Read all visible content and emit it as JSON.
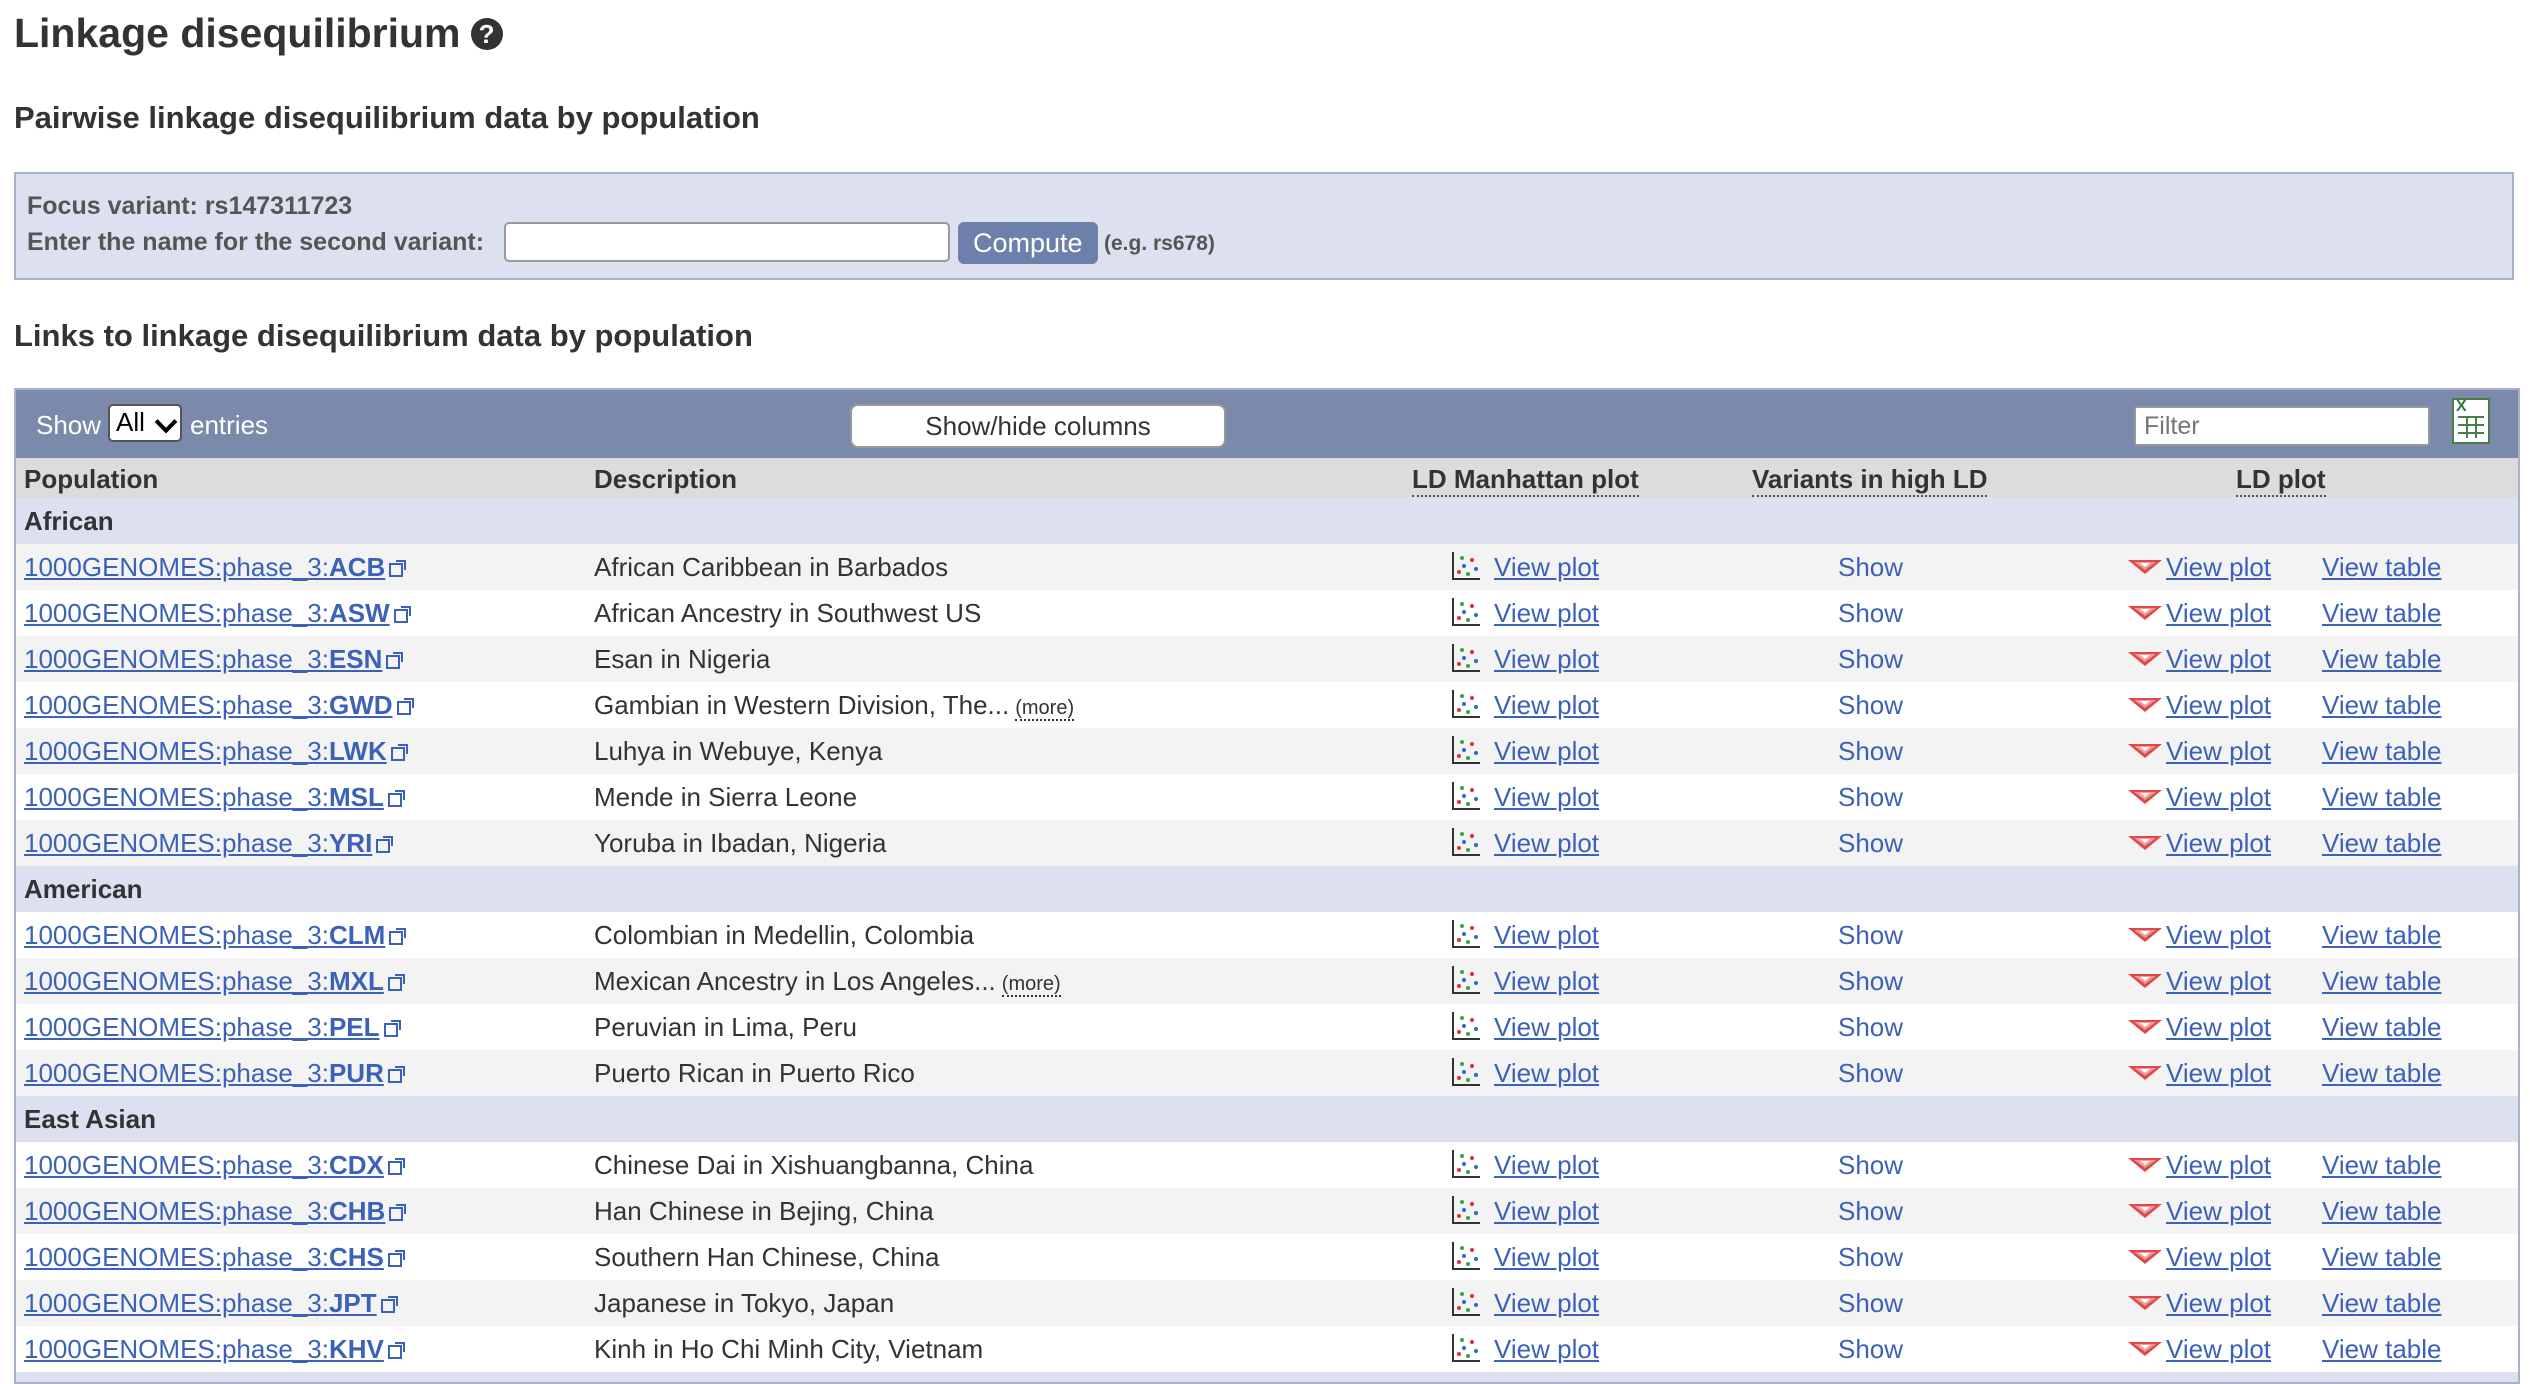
{
  "page": {
    "title": "Linkage disequilibrium",
    "section1_title": "Pairwise linkage disequilibrium data by population",
    "section2_title": "Links to linkage disequilibrium data by population"
  },
  "focus": {
    "label": "Focus variant: rs147311723",
    "second_label": "Enter the name for the second variant:",
    "input_value": "",
    "compute_label": "Compute",
    "example": "(e.g. rs678)"
  },
  "table": {
    "show_label": "Show",
    "show_value": "All",
    "entries_label": "entries",
    "showhide_label": "Show/hide columns",
    "filter_placeholder": "Filter",
    "columns": {
      "population": "Population",
      "description": "Description",
      "manhattan": "LD Manhattan plot",
      "variants": "Variants in high LD",
      "ldplot": "LD plot"
    },
    "action_labels": {
      "view_plot": "View plot",
      "show": "Show",
      "view_table": "View table",
      "more": "(more)"
    },
    "groups": [
      {
        "name": "African",
        "rows": [
          {
            "prefix": "1000GENOMES:phase_3:",
            "code": "ACB",
            "desc": "African Caribbean in Barbados",
            "more": false
          },
          {
            "prefix": "1000GENOMES:phase_3:",
            "code": "ASW",
            "desc": "African Ancestry in Southwest US",
            "more": false
          },
          {
            "prefix": "1000GENOMES:phase_3:",
            "code": "ESN",
            "desc": "Esan in Nigeria",
            "more": false
          },
          {
            "prefix": "1000GENOMES:phase_3:",
            "code": "GWD",
            "desc": "Gambian in Western Division, The...",
            "more": true
          },
          {
            "prefix": "1000GENOMES:phase_3:",
            "code": "LWK",
            "desc": "Luhya in Webuye, Kenya",
            "more": false
          },
          {
            "prefix": "1000GENOMES:phase_3:",
            "code": "MSL",
            "desc": "Mende in Sierra Leone",
            "more": false
          },
          {
            "prefix": "1000GENOMES:phase_3:",
            "code": "YRI",
            "desc": "Yoruba in Ibadan, Nigeria",
            "more": false
          }
        ]
      },
      {
        "name": "American",
        "rows": [
          {
            "prefix": "1000GENOMES:phase_3:",
            "code": "CLM",
            "desc": "Colombian in Medellin, Colombia",
            "more": false
          },
          {
            "prefix": "1000GENOMES:phase_3:",
            "code": "MXL",
            "desc": "Mexican Ancestry in Los Angeles...",
            "more": true
          },
          {
            "prefix": "1000GENOMES:phase_3:",
            "code": "PEL",
            "desc": "Peruvian in Lima, Peru",
            "more": false
          },
          {
            "prefix": "1000GENOMES:phase_3:",
            "code": "PUR",
            "desc": "Puerto Rican in Puerto Rico",
            "more": false
          }
        ]
      },
      {
        "name": "East Asian",
        "rows": [
          {
            "prefix": "1000GENOMES:phase_3:",
            "code": "CDX",
            "desc": "Chinese Dai in Xishuangbanna, China",
            "more": false
          },
          {
            "prefix": "1000GENOMES:phase_3:",
            "code": "CHB",
            "desc": "Han Chinese in Bejing, China",
            "more": false
          },
          {
            "prefix": "1000GENOMES:phase_3:",
            "code": "CHS",
            "desc": "Southern Han Chinese, China",
            "more": false
          },
          {
            "prefix": "1000GENOMES:phase_3:",
            "code": "JPT",
            "desc": "Japanese in Tokyo, Japan",
            "more": false
          },
          {
            "prefix": "1000GENOMES:phase_3:",
            "code": "KHV",
            "desc": "Kinh in Ho Chi Minh City, Vietnam",
            "more": false
          }
        ]
      }
    ]
  },
  "colors": {
    "link": "#3c61b8",
    "toolbar": "#7b89aa",
    "group_row": "#dde1ef",
    "focus_bg": "#dde1ef",
    "compute_btn": "#6d80ac"
  }
}
